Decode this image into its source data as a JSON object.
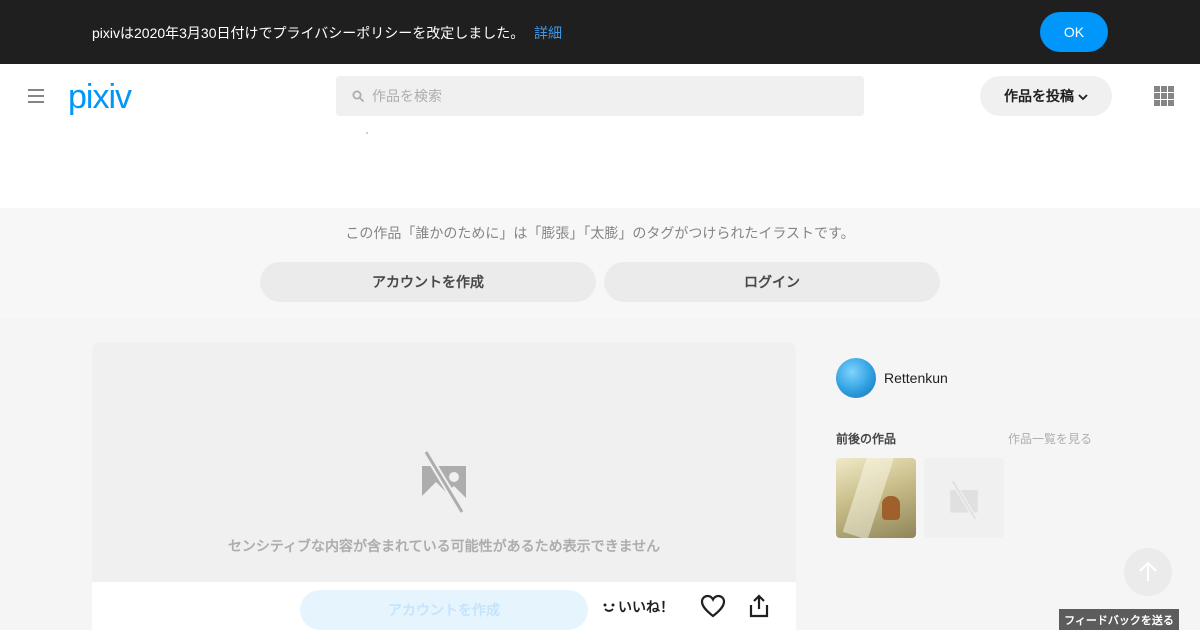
{
  "banner": {
    "text": "pixivは2020年3月30日付けでプライバシーポリシーを改定しました。",
    "link": "詳細",
    "ok": "OK"
  },
  "header": {
    "logo": "pixiv",
    "search_placeholder": "作品を検索",
    "post_button": "作品を投稿"
  },
  "tagband": {
    "description": "この作品「誰かのために」は「膨張」「太膨」のタグがつけられたイラストです。",
    "create_account": "アカウントを作成",
    "login": "ログイン"
  },
  "artwork": {
    "sensitive_message": "センシティブな内容が含まれている可能性があるため表示できません",
    "create_account": "アカウントを作成",
    "like": "いいね！"
  },
  "sidebar": {
    "author_name": "Rettenkun",
    "prevnext_title": "前後の作品",
    "see_all": "作品一覧を見る"
  },
  "feedback": "フィードバックを送る",
  "colors": {
    "accent": "#0096fa",
    "banner_bg": "#1f1f1f",
    "link": "#3d9aeb"
  },
  "icons": [
    "menu-icon",
    "search-icon",
    "chevron-down-icon",
    "apps-grid-icon",
    "hidden-image-icon",
    "smile-icon",
    "heart-icon",
    "share-icon",
    "arrow-up-icon"
  ]
}
